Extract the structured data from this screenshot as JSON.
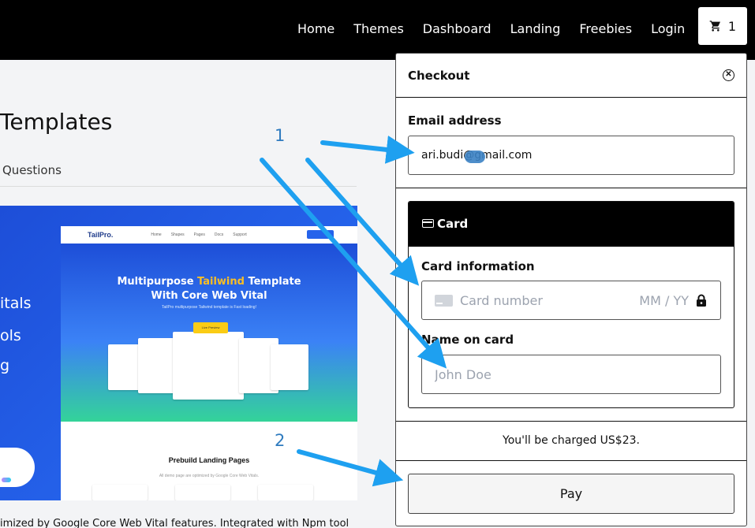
{
  "nav": {
    "links": [
      "Home",
      "Themes",
      "Dashboard",
      "Landing",
      "Freebies",
      "Login"
    ],
    "cart_count": "1"
  },
  "background": {
    "title": "Templates",
    "subtitle": "Questions",
    "hero_side_lines": [
      "itals",
      "ols",
      "g"
    ],
    "preview": {
      "brand": "TailPro.",
      "nav_items": [
        "Home",
        "Shapes",
        "Pages",
        "Docs",
        "Support"
      ],
      "headline_pre": "Multipurpose ",
      "headline_highlight": "Tailwind",
      "headline_post": " Template",
      "headline_line2": "With Core Web Vital",
      "caption": "TailPro multipurpose Tailwind template is Fast loading!",
      "button": "Live Preview",
      "lower_title": "Prebuild Landing Pages",
      "lower_sub": "All demo page are optimized by Google Core Web Vitals."
    },
    "bottom_text": "imized by Google Core Web Vital features. Integrated with Npm tool"
  },
  "annotations": {
    "step1": "1",
    "step2": "2",
    "arrow_color": "#1ea0f0"
  },
  "checkout": {
    "title": "Checkout",
    "email_label": "Email address",
    "email_value": "ari.budi@gmail.com",
    "card_section_label": "Card",
    "card_info_label": "Card information",
    "card_number_placeholder": "Card number",
    "expiry_placeholder": "MM / YY",
    "name_label": "Name on card",
    "name_placeholder": "John Doe",
    "charge_text": "You'll be charged US$23.",
    "pay_label": "Pay"
  }
}
